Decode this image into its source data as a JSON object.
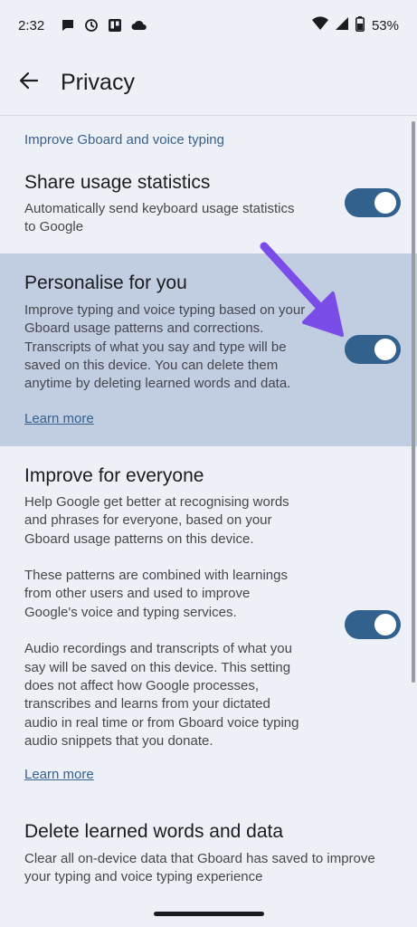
{
  "status_bar": {
    "time": "2:32",
    "battery": "53%",
    "icons": [
      "chat-bubble-icon",
      "clock-icon",
      "trello-icon",
      "cloud-icon",
      "wifi-icon",
      "signal-icon",
      "battery-icon"
    ]
  },
  "app_bar": {
    "back_icon": "arrow-left-icon",
    "title": "Privacy"
  },
  "section": {
    "header": "Improve Gboard and voice typing"
  },
  "preferences": [
    {
      "title": "Share usage statistics",
      "summary_lines": [
        "Automatically send keyboard usage statistics",
        "to Google"
      ],
      "toggle_on": true
    },
    {
      "title": "Personalise for you",
      "summary_lines": [
        "Improve typing and voice typing based on your",
        "Gboard usage patterns and corrections.",
        "Transcripts of what you say and type will be",
        "saved on this device. You can delete them",
        "anytime by deleting learned words and data."
      ],
      "link": "Learn more",
      "toggle_on": true,
      "highlighted": true
    },
    {
      "title": "Improve for everyone",
      "summary_lines": [
        "Help Google get better at recognising words",
        "and phrases for everyone, based on your",
        "Gboard usage patterns on this device.",
        "",
        "These patterns are combined with learnings",
        "from other users and used to improve",
        "Google's voice and typing services.",
        "",
        "Audio recordings and transcripts of what you",
        "say will be saved on this device. This setting",
        "does not affect how Google processes,",
        "transcribes and learns from your dictated",
        "audio in real time or from Gboard voice typing",
        "audio snippets that you donate."
      ],
      "link": "Learn more",
      "toggle_on": true
    },
    {
      "title": "Delete learned words and data",
      "summary_lines": [
        "Clear all on-device data that Gboard has saved to improve",
        "your typing and voice typing experience"
      ]
    }
  ],
  "colors": {
    "background": "#eef0f8",
    "highlight": "#c1cde0",
    "accent": "#37618e",
    "toggle_track": "#33618e",
    "annotation_arrow": "#7a4de8"
  }
}
